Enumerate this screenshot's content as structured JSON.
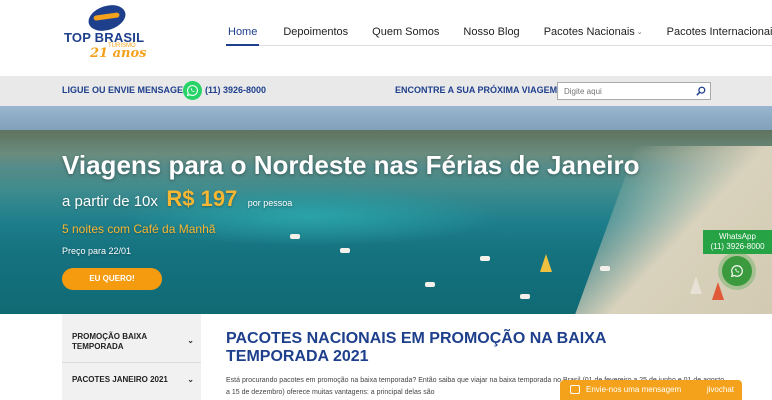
{
  "logo": {
    "brand": "TOP BRASIL",
    "tagline": "TURISMO",
    "years": "21 anos"
  },
  "nav": {
    "items": [
      {
        "label": "Home",
        "active": true,
        "dropdown": false
      },
      {
        "label": "Depoimentos",
        "active": false,
        "dropdown": false
      },
      {
        "label": "Quem Somos",
        "active": false,
        "dropdown": false
      },
      {
        "label": "Nosso Blog",
        "active": false,
        "dropdown": false
      },
      {
        "label": "Pacotes Nacionais",
        "active": false,
        "dropdown": true
      },
      {
        "label": "Pacotes Internacionais",
        "active": false,
        "dropdown": true
      }
    ],
    "caret": "⌄"
  },
  "contact": {
    "label": "LIGUE OU ENVIE MENSAGEM:",
    "phone": "(11) 3926-8000",
    "trip_label": "ENCONTRE A SUA PRÓXIMA VIAGEM:",
    "search_placeholder": "Digite aqui"
  },
  "hero": {
    "title": "Viagens para o Nordeste nas Férias de Janeiro",
    "price_prefix": "a partir de 10x",
    "price": "R$ 197",
    "price_suffix": "por pessoa",
    "nights": "5 noites com Café da Manhã",
    "valid": "Preço para 22/01",
    "button": "EU QUERO!"
  },
  "whatsapp_float": {
    "label": "WhatsApp",
    "phone": "(11) 3926-8000"
  },
  "sidebar": {
    "items": [
      {
        "label": "PROMOÇÃO BAIXA TEMPORADA"
      },
      {
        "label": "PACOTES JANEIRO 2021"
      }
    ],
    "chevron": "⌄"
  },
  "main": {
    "title": "PACOTES NACIONAIS EM PROMOÇÃO NA BAIXA TEMPORADA 2021",
    "paragraph": "Está procurando pacotes em promoção na baixa temporada? Então saiba que viajar na baixa temporada no Brasil (01 de fevereiro a 25 de junho e 01 de agosto a 15 de dezembro) oferece muitas vantagens: a principal delas são"
  },
  "chat": {
    "label": "Envie-nos uma mensagem",
    "brand": "jivochat"
  },
  "colors": {
    "primary": "#1e3f8c",
    "accent": "#f4a21b",
    "whatsapp": "#25d366"
  }
}
